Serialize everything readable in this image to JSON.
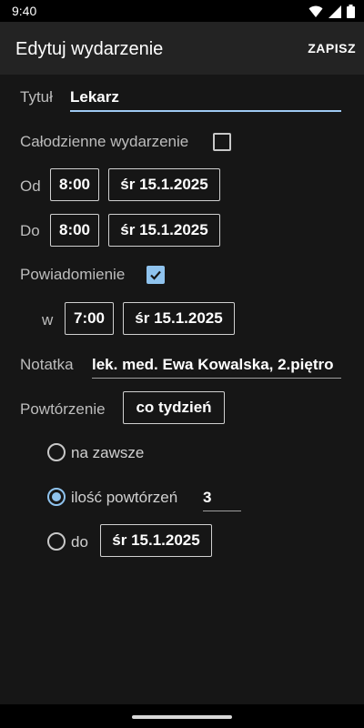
{
  "status": {
    "time": "9:40"
  },
  "appbar": {
    "title": "Edytuj wydarzenie",
    "save": "ZAPISZ"
  },
  "form": {
    "title_label": "Tytuł",
    "title_value": "Lekarz",
    "allday_label": "Całodzienne wydarzenie",
    "allday_checked": false,
    "from_label": "Od",
    "from_time": "8:00",
    "from_date": "śr 15.1.2025",
    "to_label": "Do",
    "to_time": "8:00",
    "to_date": "śr 15.1.2025",
    "notify_label": "Powiadomienie",
    "notify_checked": true,
    "notify_at_label": "w",
    "notify_time": "7:00",
    "notify_date": "śr 15.1.2025",
    "note_label": "Notatka",
    "note_value": "lek. med. Ewa Kowalska, 2.piętro",
    "repeat_label": "Powtórzenie",
    "repeat_value": "co tydzień",
    "forever_label": "na zawsze",
    "count_label": "ilość powtórzeń",
    "count_value": "3",
    "until_label": "do",
    "until_date": "śr 15.1.2025",
    "selected_repeat_end": "count"
  },
  "colors": {
    "accent": "#8fc3ee",
    "background": "#161616",
    "appbar": "#232323"
  }
}
